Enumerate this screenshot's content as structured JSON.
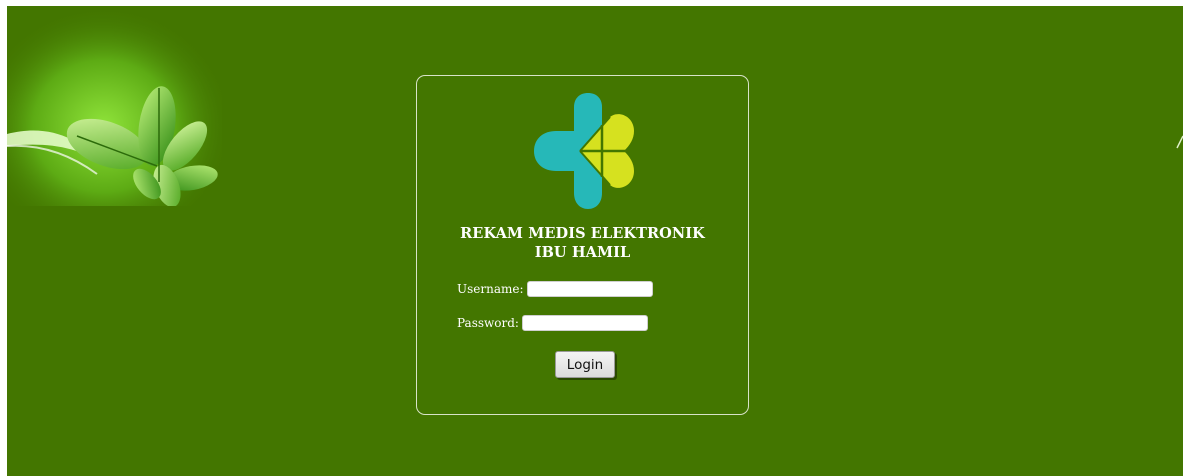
{
  "app": {
    "title_line1": "REKAM MEDIS ELEKTRONIK",
    "title_line2": "IBU HAMIL"
  },
  "form": {
    "username_label": "Username:",
    "username_value": "",
    "password_label": "Password:",
    "password_value": "",
    "login_label": "Login"
  },
  "colors": {
    "background": "#437600",
    "logo_teal": "#26b8b8",
    "logo_lime": "#d6e11f"
  },
  "icons": {
    "logo": "kemenkes-logo-icon",
    "decoration": "green-leaves-icon"
  }
}
